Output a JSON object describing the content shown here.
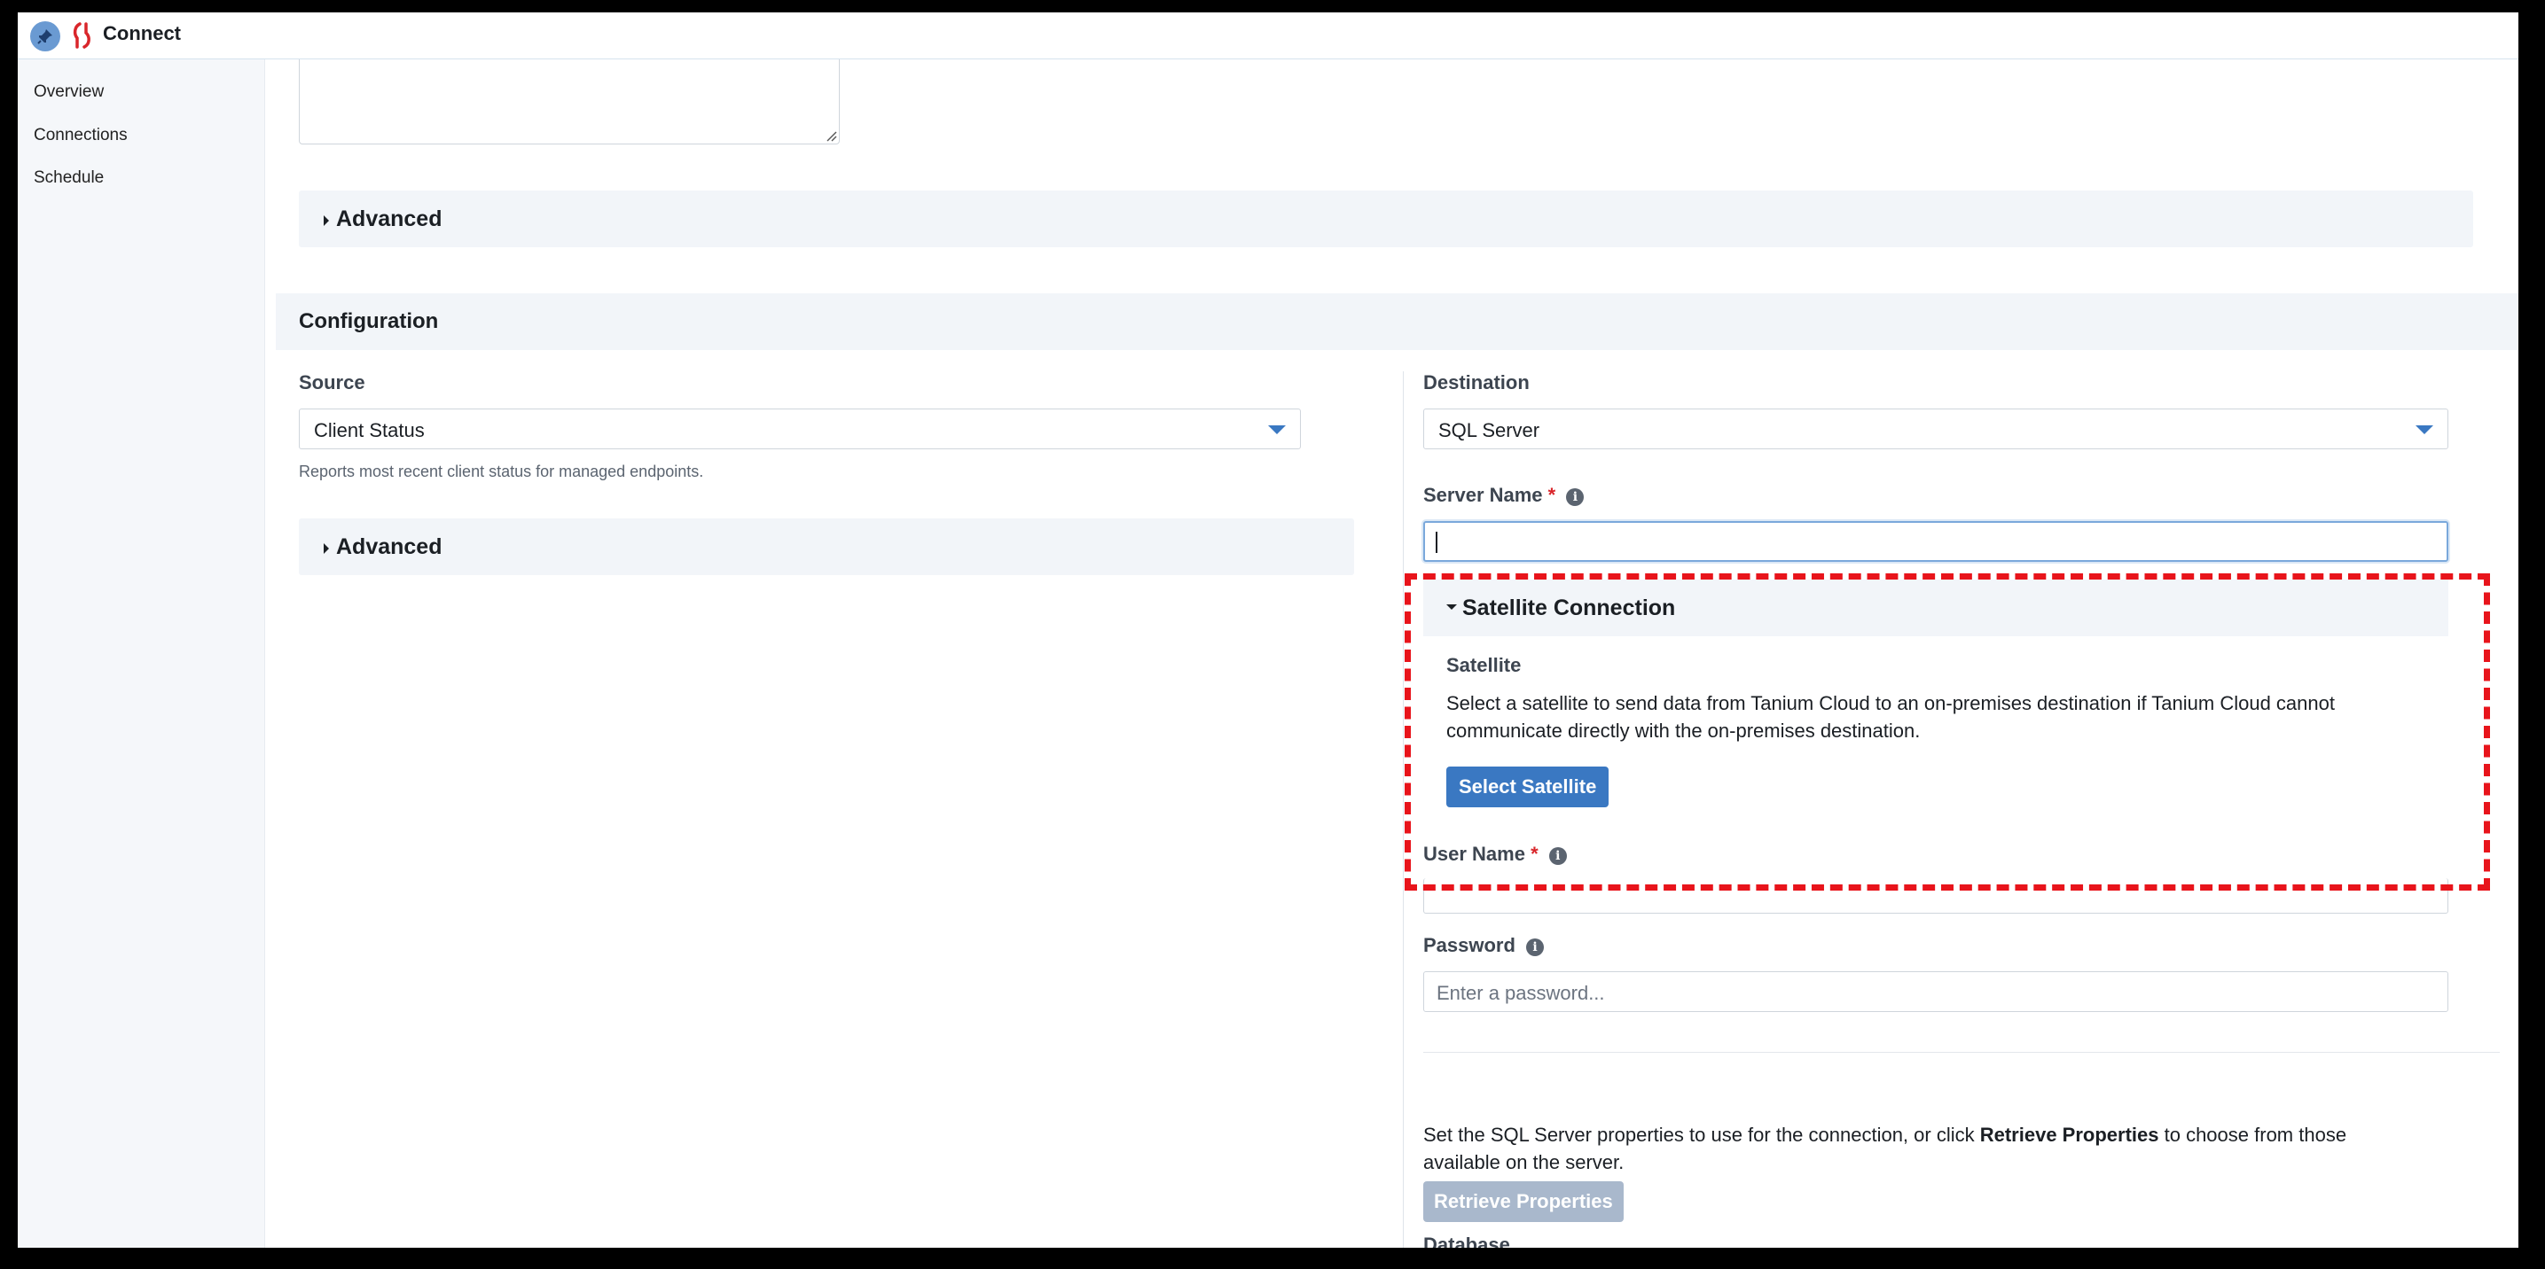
{
  "app": {
    "title": "Connect"
  },
  "sidebar": {
    "items": [
      {
        "label": "Overview"
      },
      {
        "label": "Connections"
      },
      {
        "label": "Schedule"
      }
    ]
  },
  "general": {
    "advanced_label": "Advanced"
  },
  "configuration": {
    "title": "Configuration",
    "source": {
      "label": "Source",
      "selected": "Client Status",
      "help": "Reports most recent client status for managed endpoints.",
      "advanced_label": "Advanced"
    },
    "destination": {
      "label": "Destination",
      "selected": "SQL Server",
      "server_name": {
        "label": "Server Name",
        "required_mark": "*",
        "value": ""
      },
      "satellite_connection": {
        "title": "Satellite Connection",
        "satellite_label": "Satellite",
        "description": "Select a satellite to send data from Tanium Cloud to an on-premises destination if Tanium Cloud cannot communicate directly with the on-premises destination.",
        "select_button": "Select Satellite"
      },
      "user_name": {
        "label": "User Name",
        "required_mark": "*"
      },
      "password": {
        "label": "Password",
        "placeholder": "Enter a password..."
      },
      "properties": {
        "text_before": "Set the SQL Server properties to use for the connection, or click ",
        "text_bold": "Retrieve Properties",
        "text_after": " to choose from those available on the server.",
        "retrieve_button": "Retrieve Properties",
        "next_label_partial": "Database"
      }
    }
  },
  "colors": {
    "accent": "#3a78c2",
    "highlight": "#e8141b",
    "required": "#d9262b",
    "disabled_button": "#a9b8cc"
  },
  "icons": [
    "pin-icon",
    "connect-logo-icon",
    "caret-right-icon",
    "caret-down-icon",
    "dropdown-arrow-icon",
    "info-icon",
    "resize-grip-icon"
  ]
}
